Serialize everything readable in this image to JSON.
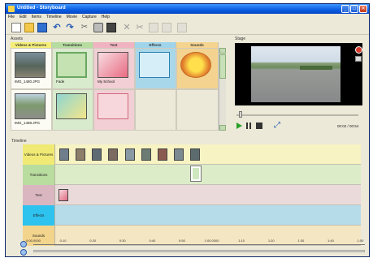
{
  "window": {
    "title": "Untitled - Storyboard"
  },
  "menu": [
    "File",
    "Edit",
    "Items",
    "Timeline",
    "Movie",
    "Capture",
    "Help"
  ],
  "assets": {
    "title": "Assets",
    "columns": [
      "Videos & Pictures",
      "Transitions",
      "Text",
      "Effects",
      "Sounds"
    ],
    "items": [
      {
        "label": "IMG_1480.JPG",
        "col": 0,
        "row": 0
      },
      {
        "label": "Fade",
        "col": 1,
        "row": 0
      },
      {
        "label": "My School",
        "col": 2,
        "row": 0
      },
      {
        "label": "",
        "col": 3,
        "row": 0
      },
      {
        "label": "",
        "col": 4,
        "row": 0
      },
      {
        "label": "IMG_1488.JPG",
        "col": 0,
        "row": 1
      },
      {
        "label": "",
        "col": 1,
        "row": 1
      },
      {
        "label": "",
        "col": 2,
        "row": 1
      }
    ]
  },
  "stage": {
    "title": "Stage",
    "time": "00:02 / 00:54",
    "progress": 0.02
  },
  "timeline": {
    "title": "Timeline",
    "tracks": [
      "Videos & Pictures",
      "Transitions",
      "Text",
      "Effects",
      "Sounds"
    ],
    "ruler": [
      "0:00.0000",
      "0:10",
      "0:20",
      "0:30",
      "0:40",
      "0:50",
      "1:00.0000",
      "1:10",
      "1:20",
      "1:30",
      "1:40",
      "1:50"
    ]
  }
}
